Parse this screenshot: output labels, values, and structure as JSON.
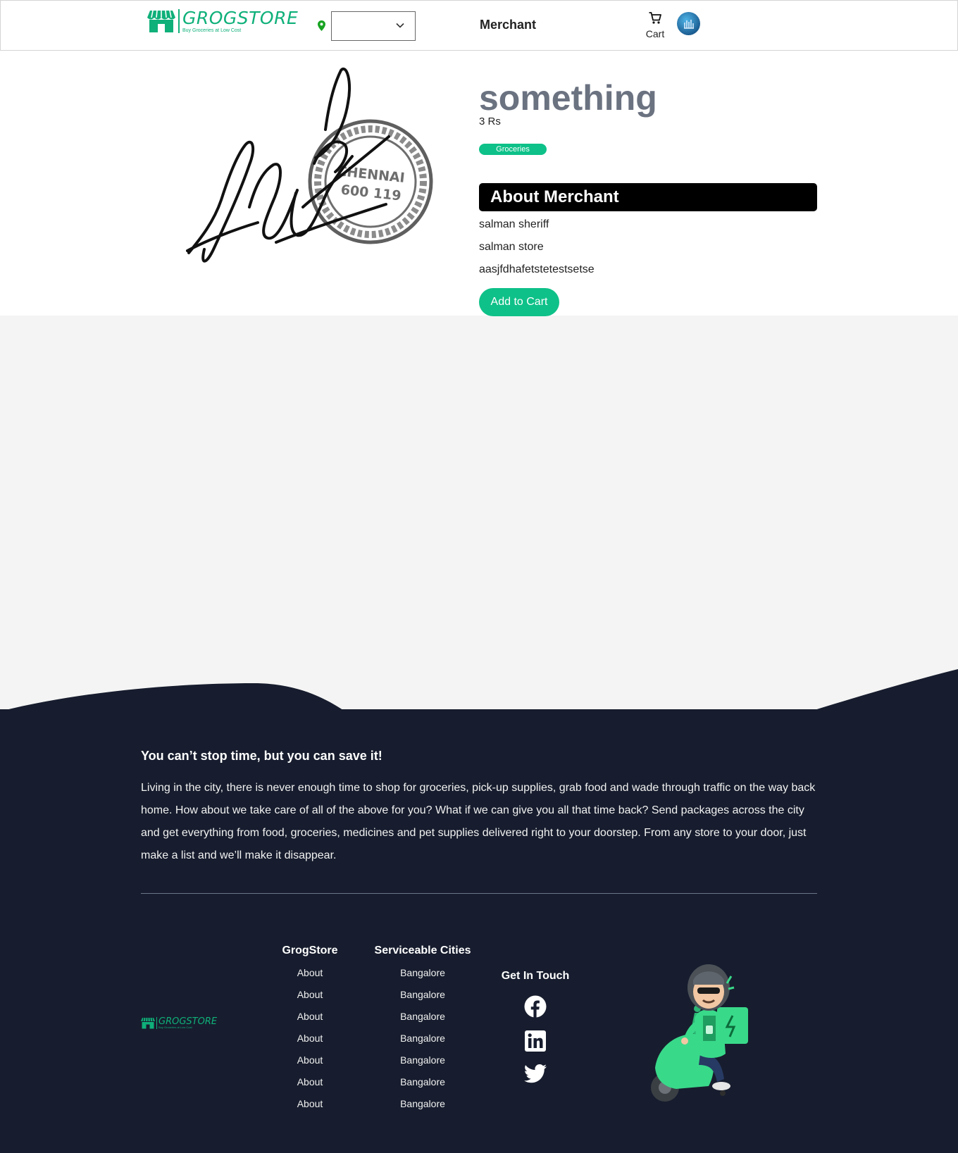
{
  "header": {
    "logo_text": "GROGSTORE",
    "logo_tagline": "Buy Groceries at Low Cost",
    "location_value": "",
    "nav_merchant": "Merchant",
    "cart_label": "Cart"
  },
  "product": {
    "title": "something",
    "price": "3 Rs",
    "category": "Groceries",
    "about_heading": "About Merchant",
    "merchant_name": "salman sheriff",
    "store_name": "salman store",
    "description": "aasjfdhafetstetestsetse",
    "add_to_cart_label": "Add to Cart",
    "stamp_lines": [
      "CHENNAI",
      "600 119"
    ]
  },
  "footer": {
    "heading": "You can’t stop time, but you can save it!",
    "body": "Living in the city, there is never enough time to shop for groceries, pick-up supplies, grab food and wade through traffic on the way back home. How about we take care of all of the above for you? What if we can give you all that time back? Send packages across the city and get everything from food, groceries, medicines and pet supplies delivered right to your doorstep. From any store to your door, just make a list and we’ll make it disappear.",
    "logo_text": "GROGSTORE",
    "logo_tagline": "Buy Groceries at Low Cost",
    "grogstore": {
      "title": "GrogStore",
      "links": [
        "About",
        "About",
        "About",
        "About",
        "About",
        "About",
        "About"
      ]
    },
    "cities": {
      "title": "Serviceable Cities",
      "links": [
        "Bangalore",
        "Bangalore",
        "Bangalore",
        "Bangalore",
        "Bangalore",
        "Bangalore",
        "Bangalore"
      ]
    },
    "contact": {
      "title": "Get In Touch",
      "icons": [
        "facebook-icon",
        "linkedin-icon",
        "twitter-icon"
      ]
    }
  },
  "colors": {
    "brand": "#0ec188",
    "footer_bg": "#171d2e",
    "title_gray": "#6b7280"
  }
}
